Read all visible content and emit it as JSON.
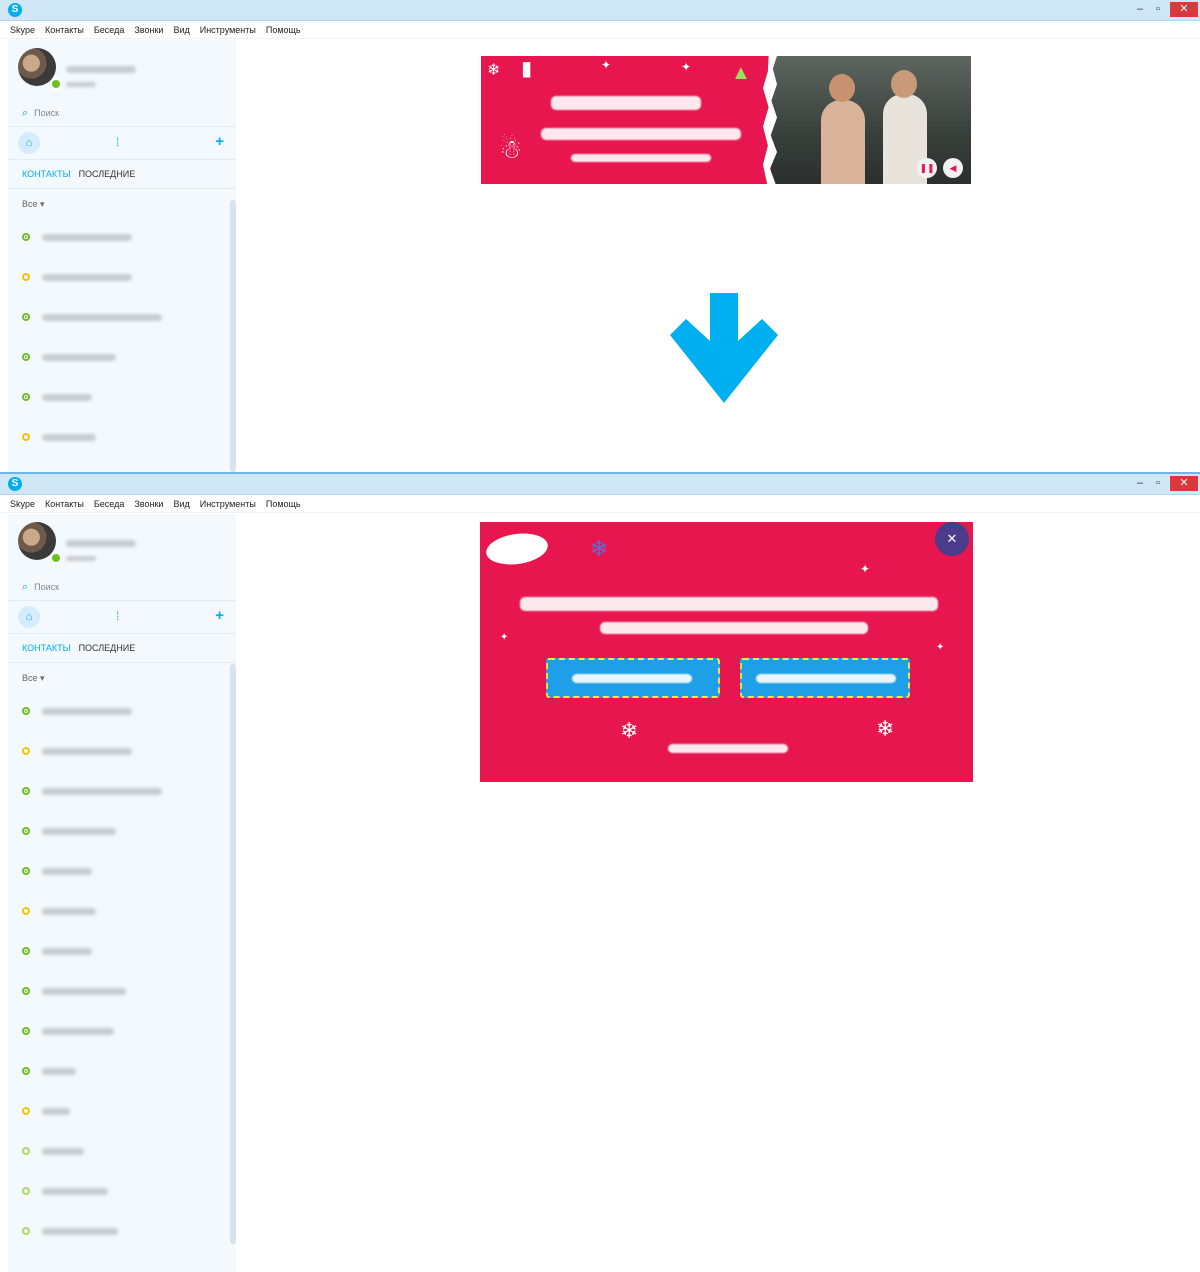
{
  "window": {
    "title_icon": "skype-icon",
    "controls": {
      "minimize": "–",
      "maximize": "▫",
      "close": "✕"
    }
  },
  "menu": [
    "Skype",
    "Контакты",
    "Беседа",
    "Звонки",
    "Вид",
    "Инструменты",
    "Помощь"
  ],
  "sidebar": {
    "search_label": "Поиск",
    "tabs": {
      "contacts": "КОНТАКТЫ",
      "recent": "ПОСЛЕДНИЕ"
    },
    "filter_label": "Все ▾",
    "add_icon": "+"
  },
  "window1_contacts": [
    {
      "status": "online"
    },
    {
      "status": "away"
    },
    {
      "status": "online"
    },
    {
      "status": "online"
    },
    {
      "status": "online"
    },
    {
      "status": "away"
    }
  ],
  "window2_contacts": [
    {
      "status": "online"
    },
    {
      "status": "away"
    },
    {
      "status": "online"
    },
    {
      "status": "online"
    },
    {
      "status": "online"
    },
    {
      "status": "away"
    },
    {
      "status": "online"
    },
    {
      "status": "online"
    },
    {
      "status": "online"
    },
    {
      "status": "online"
    },
    {
      "status": "away"
    },
    {
      "status": "offline"
    },
    {
      "status": "offline"
    },
    {
      "status": "offline"
    }
  ],
  "colors": {
    "skype_blue": "#00aff0",
    "banner_red": "#e8164f",
    "online": "#6cbf1e",
    "away": "#f2c200",
    "close_red": "#d9393a"
  },
  "icons": {
    "home": "⌂",
    "search": "🔍",
    "dialpad": "⁞",
    "arrow": "arrow-down-icon"
  }
}
